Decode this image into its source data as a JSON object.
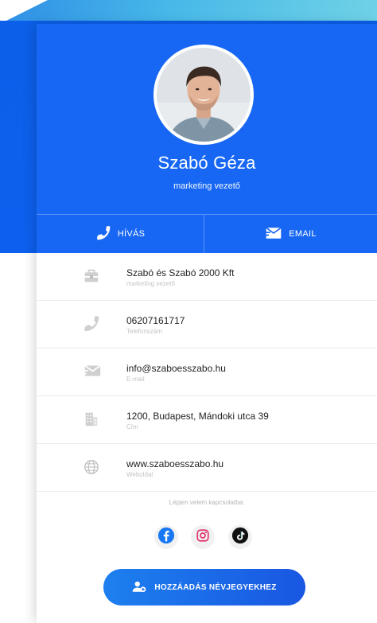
{
  "profile": {
    "name": "Szabó Géza",
    "role": "marketing vezető"
  },
  "actions": {
    "call_label": "HÍVÁS",
    "email_label": "EMAIL"
  },
  "contact_rows": [
    {
      "icon": "briefcase-icon",
      "value": "Szabó és Szabó 2000 Kft",
      "label": "marketing vezető"
    },
    {
      "icon": "phone-icon",
      "value": "06207161717",
      "label": "Telefonszám"
    },
    {
      "icon": "mail-icon",
      "value": "info@szaboesszabo.hu",
      "label": "E-mail"
    },
    {
      "icon": "building-icon",
      "value": "1200, Budapest, Mándoki utca 39",
      "label": "Cím"
    },
    {
      "icon": "globe-icon",
      "value": "www.szaboesszabo.hu",
      "label": "Weboldal"
    }
  ],
  "social": {
    "label": "Lépjen velem kapcsolatba:",
    "items": [
      "facebook-icon",
      "instagram-icon",
      "tiktok-icon"
    ]
  },
  "add_contact_label": "HOZZÁADÁS NÉVJEGYEKHEZ",
  "colors": {
    "primary_blue": "#1767f4",
    "facebook": "#1877f2",
    "instagram": "#e1306c",
    "tiktok": "#111111"
  }
}
